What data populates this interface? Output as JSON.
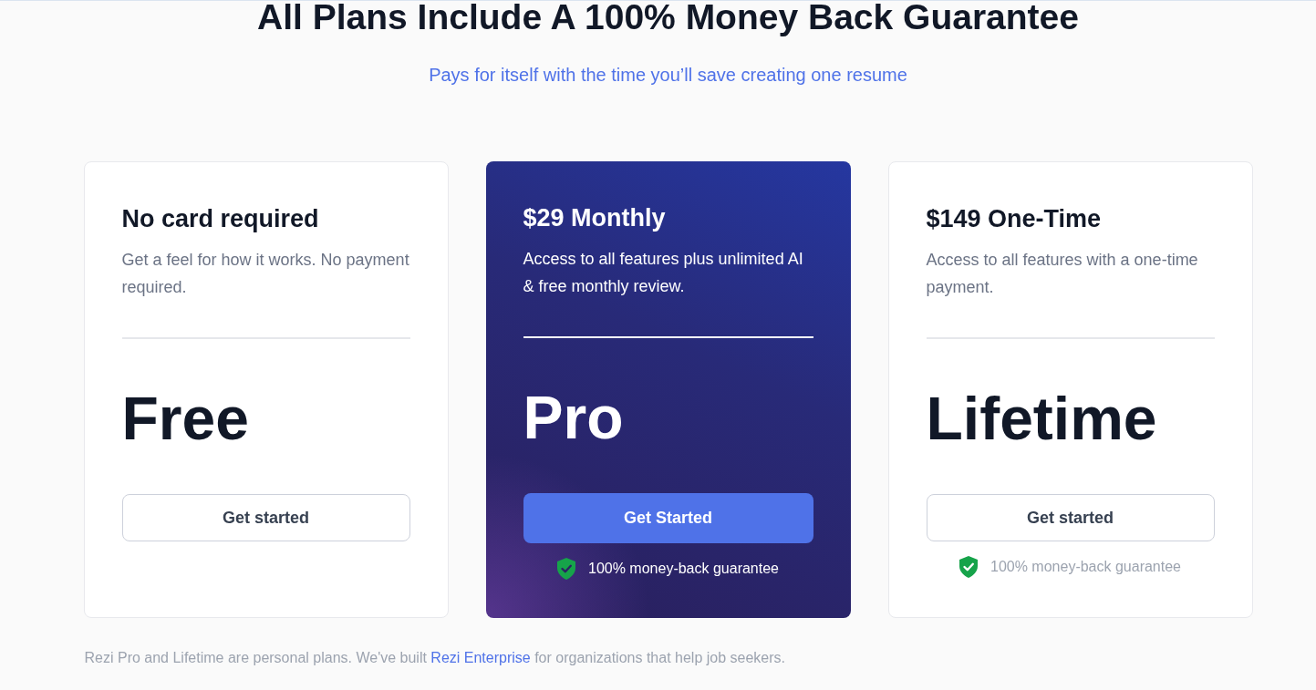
{
  "heading": "All Plans Include A 100% Money Back Guarantee",
  "subtitle": "Pays for itself with the time you’ll save creating one resume",
  "plans": [
    {
      "kind": "standard",
      "title": "No card required",
      "description": "Get a feel for how it works. No payment required.",
      "name": "Free",
      "button": "Get started"
    },
    {
      "kind": "featured",
      "title": "$29 Monthly",
      "description": "Access to all features plus unlimited AI & free monthly review.",
      "name": "Pro",
      "button": "Get Started",
      "guarantee": "100% money-back guarantee"
    },
    {
      "kind": "standard",
      "title": "$149 One-Time",
      "description": "Access to all features with a one-time payment.",
      "name": "Lifetime",
      "button": "Get started",
      "guarantee": "100% money-back guarantee"
    }
  ],
  "footnote": {
    "before": "Rezi Pro and Lifetime are personal plans. We've built ",
    "link": "Rezi Enterprise",
    "after": " for organizations that help job seekers."
  }
}
